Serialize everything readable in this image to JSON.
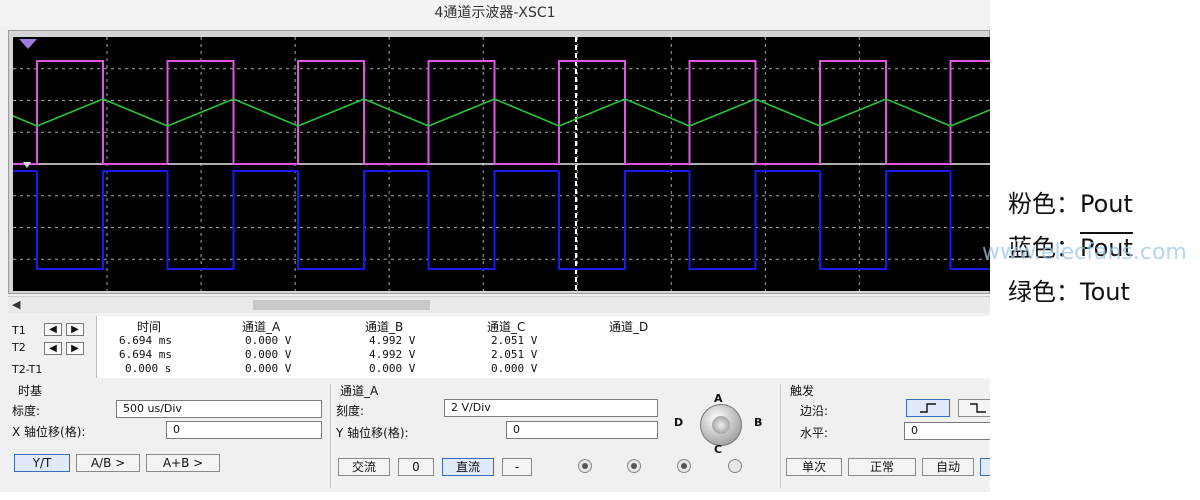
{
  "window": {
    "title": "4通道示波器-XSC1"
  },
  "scope": {
    "colors": {
      "pink": "#e056e0",
      "blue": "#1a1aee",
      "green": "#27c43a",
      "grid": "#cfcfcf",
      "background": "#000000"
    },
    "trigger_marker_icon": "trigger-arrow-icon"
  },
  "readout": {
    "rows": [
      "T1",
      "T2",
      "T2-T1"
    ],
    "headers": [
      "时间",
      "通道_A",
      "通道_B",
      "通道_C",
      "通道_D"
    ],
    "values": [
      [
        "6.694 ms",
        "0.000 V",
        "4.992 V",
        "2.051 V",
        ""
      ],
      [
        "6.694 ms",
        "0.000 V",
        "4.992 V",
        "2.051 V",
        ""
      ],
      [
        "0.000 s",
        "0.000 V",
        "0.000 V",
        "0.000 V",
        ""
      ]
    ]
  },
  "timebase": {
    "title": "时基",
    "scale_label": "标度:",
    "scale_value": "500 us/Div",
    "xpos_label": "X 轴位移(格):",
    "xpos_value": "0",
    "buttons": [
      "Y/T",
      "A/B >",
      "A+B >"
    ]
  },
  "channel": {
    "title": "通道_A",
    "scale_label": "刻度:",
    "scale_value": "2  V/Div",
    "ypos_label": "Y 轴位移(格):",
    "ypos_value": "0",
    "coupling": [
      "交流",
      "0",
      "直流",
      "-"
    ],
    "knob_labels": [
      "A",
      "B",
      "C",
      "D"
    ]
  },
  "trigger": {
    "title": "触发",
    "edge_label": "边沿:",
    "level_label": "水平:",
    "level_value": "0",
    "edge_icons": [
      "rising-edge-icon",
      "falling-edge-icon"
    ],
    "modes": [
      "单次",
      "正常",
      "自动"
    ]
  },
  "legend": {
    "pink": {
      "label": "粉色：",
      "signal": "Pout"
    },
    "blue": {
      "label": "蓝色：",
      "signal": "Pout"
    },
    "green": {
      "label": "绿色：",
      "signal": "Tout"
    }
  },
  "watermark": "www.elecfans.com"
}
